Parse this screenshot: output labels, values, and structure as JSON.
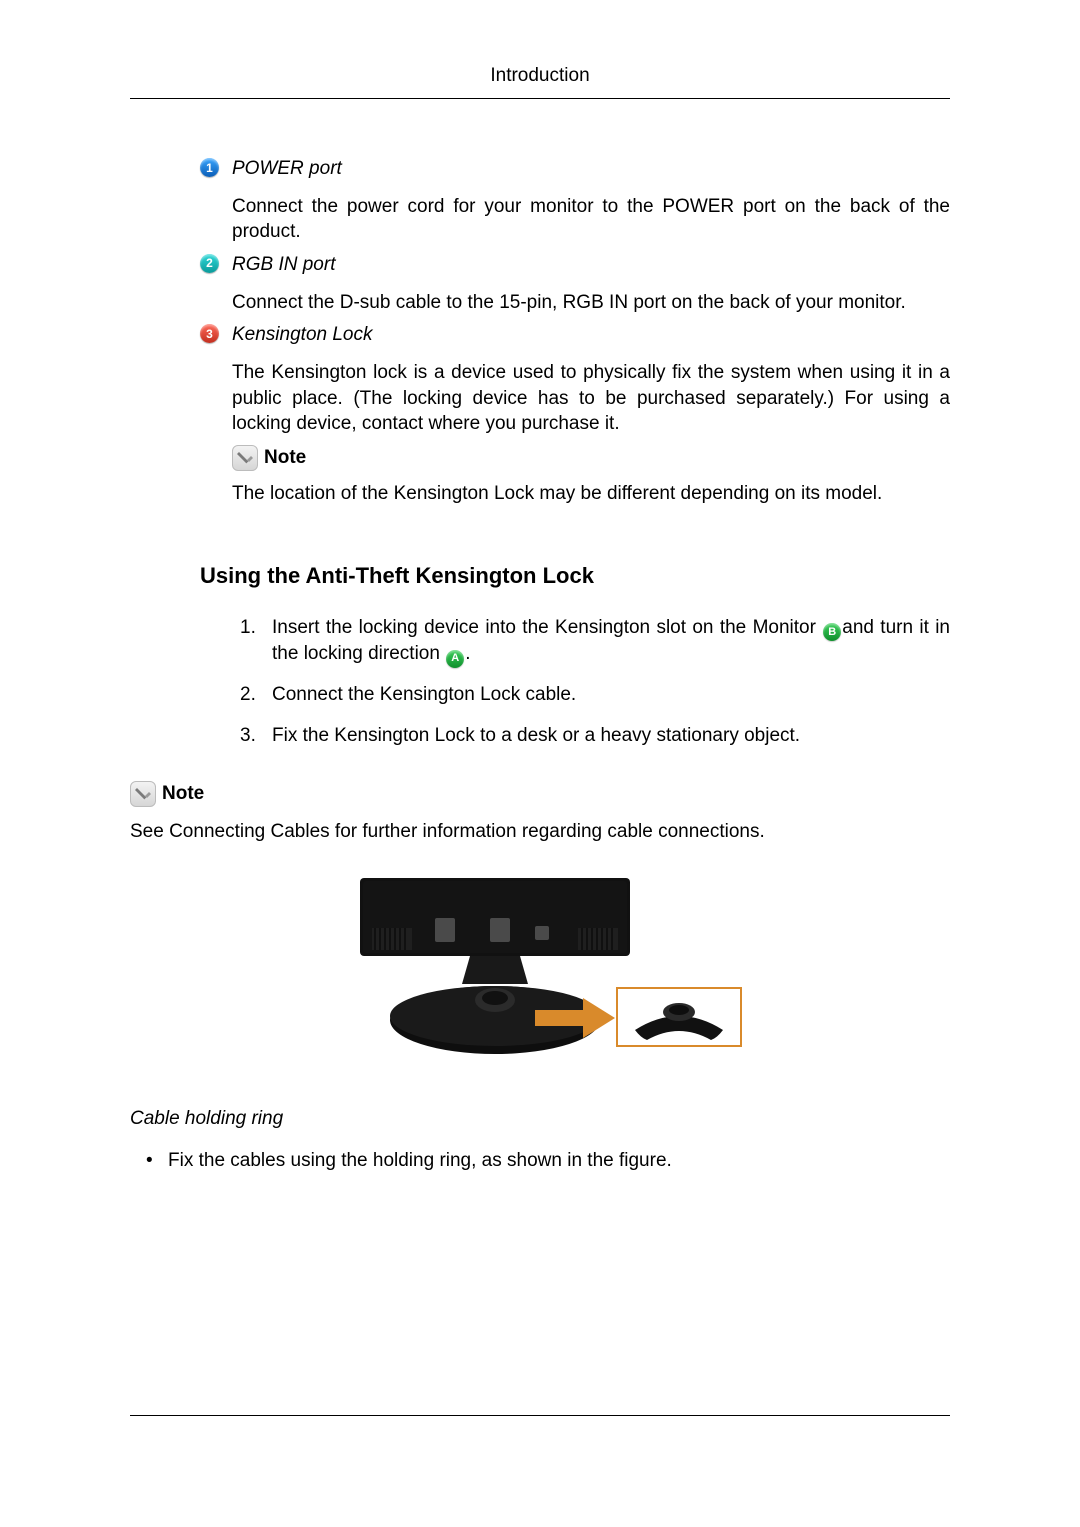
{
  "header": {
    "title": "Introduction"
  },
  "items": [
    {
      "bullet": "1",
      "title": "POWER port",
      "body": "Connect the power cord for your monitor to the POWER port on the back of the product."
    },
    {
      "bullet": "2",
      "title": "RGB IN port",
      "body": "Connect the D-sub cable to the 15-pin, RGB IN port on the back of your monitor."
    },
    {
      "bullet": "3",
      "title": "Kensington Lock",
      "body": "The Kensington lock is a device used to physically fix the system when using it in a public place. (The locking device has to be purchased separately.) For using a locking device, contact where you purchase it."
    }
  ],
  "note": {
    "label": "Note",
    "text": "The location of the Kensington Lock may be different depending on its model."
  },
  "section": {
    "heading": "Using the Anti-Theft Kensington Lock",
    "steps": [
      {
        "n": "1.",
        "pre": "Insert the locking device into the Kensington slot on the Monitor ",
        "b": "B",
        "mid": "and turn it in the locking direction ",
        "a": "A",
        "post": "."
      },
      {
        "n": "2.",
        "text": "Connect the Kensington Lock cable."
      },
      {
        "n": "3.",
        "text": "Fix the Kensington Lock to a desk or a heavy stationary object."
      }
    ]
  },
  "note2": {
    "label": "Note",
    "text": "See Connecting Cables for further information regarding cable connections."
  },
  "cable": {
    "heading": "Cable holding ring",
    "bullet": "•",
    "text": "Fix the cables using the holding ring, as shown in the figure."
  }
}
